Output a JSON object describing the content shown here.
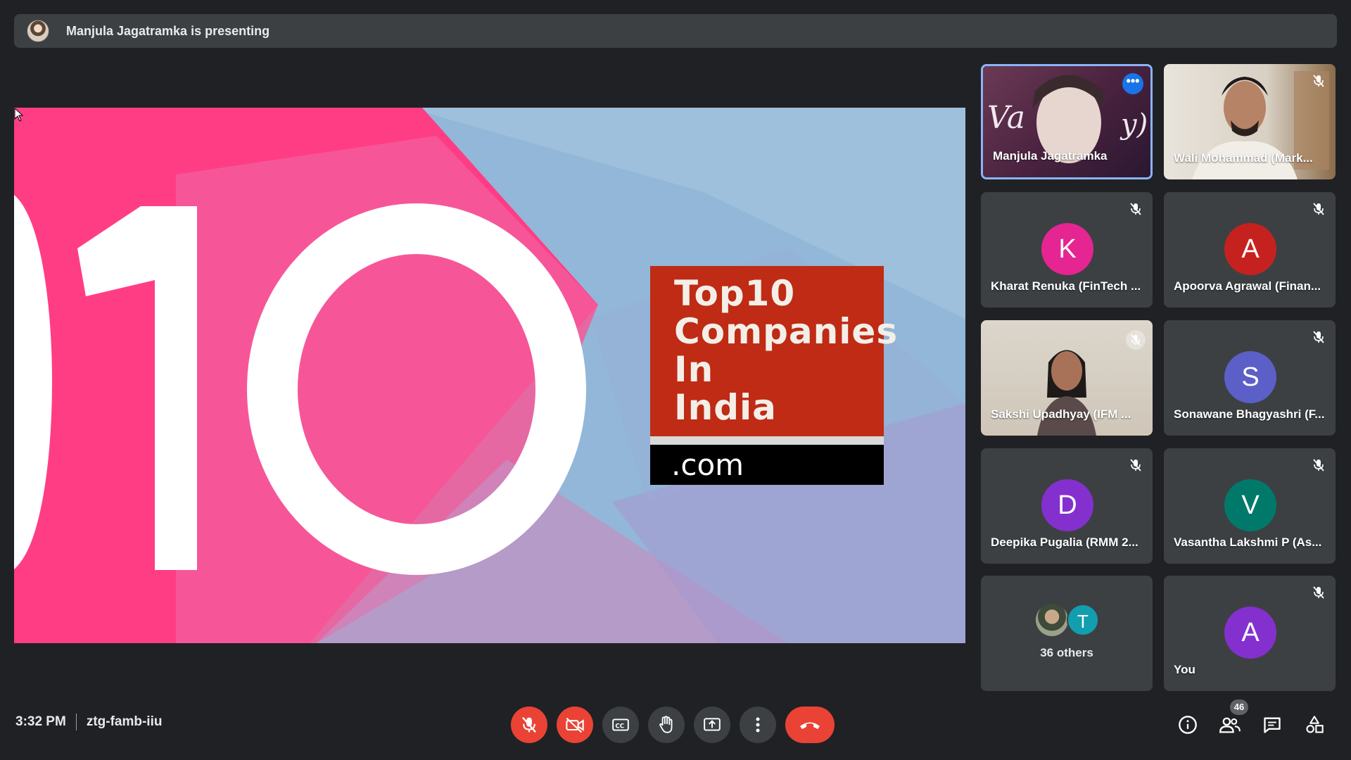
{
  "banner": {
    "text": "Manjula Jagatramka is presenting"
  },
  "slide": {
    "big_number": "10",
    "box_lines": [
      "Top10",
      "Companies",
      "In",
      "India"
    ],
    "box_suffix": ".com"
  },
  "participants": [
    {
      "name": "Manjula Jagatramka",
      "kind": "video",
      "active": true
    },
    {
      "name": "Wali Mohammad (Mark...",
      "kind": "video",
      "muted": true
    },
    {
      "name": "Kharat Renuka (FinTech ...",
      "initial": "K",
      "color": "#e52592",
      "muted": true
    },
    {
      "name": "Apoorva Agrawal (Finan...",
      "initial": "A",
      "color": "#c5221f",
      "muted": true
    },
    {
      "name": "Sakshi Upadhyay (IFM ...",
      "kind": "video",
      "muted": true
    },
    {
      "name": "Sonawane Bhagyashri (F...",
      "initial": "S",
      "color": "#5b5fc7",
      "muted": true
    },
    {
      "name": "Deepika Pugalia (RMM 2...",
      "initial": "D",
      "color": "#8430ce",
      "muted": true
    },
    {
      "name": "Vasantha Lakshmi P (As...",
      "initial": "V",
      "color": "#00796b",
      "muted": true
    },
    {
      "name": "You",
      "initial": "A",
      "color": "#8430ce",
      "muted": true
    }
  ],
  "others": {
    "label": "36 others",
    "initial": "T",
    "color": "#129eaf"
  },
  "meeting": {
    "time": "3:32 PM",
    "code": "ztg-famb-iiu"
  },
  "participant_count": "46",
  "icons": {
    "mic": "mic-off-icon",
    "camera": "camera-off-icon",
    "captions": "captions-icon",
    "hand": "raise-hand-icon",
    "present": "present-screen-icon",
    "more": "more-options-icon",
    "end": "end-call-icon",
    "info": "info-icon",
    "people": "people-icon",
    "chat": "chat-icon",
    "activities": "activities-icon"
  },
  "colors": {
    "end_call": "#ea4335",
    "active_border": "#8ab4f8",
    "background": "#202124"
  }
}
